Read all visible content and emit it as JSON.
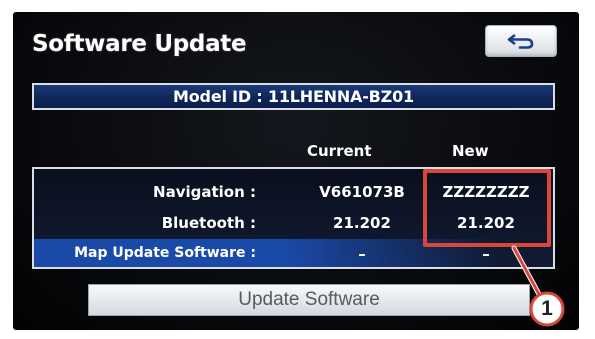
{
  "header": {
    "title": "Software Update",
    "back_icon": "return-arrow-icon"
  },
  "model": {
    "text": "Model ID : 11LHENNA-BZ01"
  },
  "columns": {
    "current": "Current",
    "new": "New"
  },
  "rows": [
    {
      "label": "Navigation :",
      "current": "V661073B",
      "new": "ZZZZZZZZ"
    },
    {
      "label": "Bluetooth :",
      "current": "21.202",
      "new": "21.202"
    },
    {
      "label": "Map Update Software :",
      "current": "–",
      "new": "–"
    }
  ],
  "actions": {
    "update_label": "Update Software"
  },
  "callout": {
    "number": "1"
  },
  "colors": {
    "highlight": "#d8473a",
    "bar_blue": "#0e2659",
    "row_blue": "#1a4aa8"
  }
}
